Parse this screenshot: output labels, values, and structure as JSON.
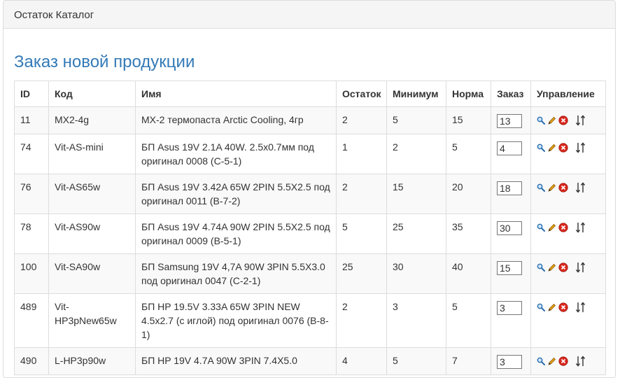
{
  "panel": {
    "title": "Остаток Каталог"
  },
  "section": {
    "title": "Заказ новой продукции"
  },
  "table": {
    "headers": {
      "id": "ID",
      "code": "Код",
      "name": "Имя",
      "stock": "Остаток",
      "min": "Минимум",
      "norm": "Норма",
      "order": "Заказ",
      "manage": "Управление"
    },
    "rows": [
      {
        "id": "11",
        "code": "MX2-4g",
        "name": "MX-2 термопаста Arctic Cooling, 4гр",
        "stock": "2",
        "min": "5",
        "norm": "15",
        "order": "13"
      },
      {
        "id": "74",
        "code": "Vit-AS-mini",
        "name": "БП Asus 19V 2.1A 40W. 2.5x0.7мм под оригинал 0008 (С-5-1)",
        "stock": "1",
        "min": "2",
        "norm": "5",
        "order": "4"
      },
      {
        "id": "76",
        "code": "Vit-AS65w",
        "name": "БП Asus 19V 3.42A 65W 2PIN 5.5X2.5 под оригинал 0011 (B-7-2)",
        "stock": "2",
        "min": "15",
        "norm": "20",
        "order": "18"
      },
      {
        "id": "78",
        "code": "Vit-AS90w",
        "name": "БП Asus 19V 4.74A 90W 2PIN 5.5X2.5 под оригинал 0009 (B-5-1)",
        "stock": "5",
        "min": "25",
        "norm": "35",
        "order": "30"
      },
      {
        "id": "100",
        "code": "Vit-SA90w",
        "name": "БП Samsung 19V 4,7A 90W 3PIN 5.5X3.0 под оригинал 0047 (C-2-1)",
        "stock": "25",
        "min": "30",
        "norm": "40",
        "order": "15"
      },
      {
        "id": "489",
        "code": "Vit-HP3pNew65w",
        "name": "БП HP 19.5V 3.33A 65W 3PIN NEW 4.5x2.7 (с иглой) под оригинал 0076 (B-8-1)",
        "stock": "2",
        "min": "3",
        "norm": "5",
        "order": "3"
      },
      {
        "id": "490",
        "code": "L-HP3p90w",
        "name": "БП HP 19V 4.7A 90W 3PIN 7.4X5.0",
        "stock": "4",
        "min": "5",
        "norm": "7",
        "order": "3"
      }
    ]
  },
  "icons": {
    "view": "magnifier-icon",
    "edit": "pencil-icon",
    "delete": "delete-icon",
    "sort": "sort-arrows-icon"
  },
  "colors": {
    "title": "#337ab7",
    "delete": "#d9281e",
    "pencil": "#e8a317"
  }
}
